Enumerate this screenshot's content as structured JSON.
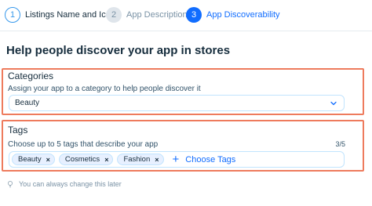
{
  "stepper": {
    "steps": [
      {
        "number": "1",
        "label": "Listings Name and Icon",
        "state": "done"
      },
      {
        "number": "2",
        "label": "App Description",
        "state": "todo"
      },
      {
        "number": "3",
        "label": "App Discoverability",
        "state": "active"
      }
    ]
  },
  "page": {
    "title": "Help people discover your app in stores"
  },
  "categories": {
    "title": "Categories",
    "subtitle": "Assign your app to a category to help people discover it",
    "selected": "Beauty"
  },
  "tags": {
    "title": "Tags",
    "subtitle": "Choose up to 5 tags that describe your app",
    "counter": "3/5",
    "chips": [
      "Beauty",
      "Cosmetics",
      "Fashion"
    ],
    "add_label": "Choose Tags"
  },
  "hint": {
    "text": "You can always change this later"
  },
  "colors": {
    "accent": "#116dff",
    "highlight_border": "#ee7b5d"
  }
}
